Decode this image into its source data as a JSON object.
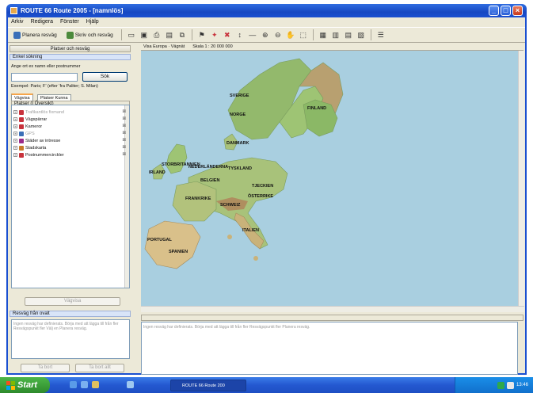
{
  "window": {
    "title": "ROUTE 66 Route 2005 - [namnlös]"
  },
  "menu": [
    "Arkiv",
    "Redigera",
    "Fönster",
    "Hjälp"
  ],
  "toolbar": {
    "plan_route_label": "Planera resväg",
    "print_route_label": "Skriv och resväg"
  },
  "left_panel": {
    "header": "Platser och resväg",
    "search_section_title": "Enkel sökning",
    "search_hint": "Ange ort ex namn eller postnummer",
    "search_input_value": "",
    "search_button": "Sök",
    "example_text": "Exempel: Paris; F’ (efter ‘fra Paliter; S. Milan)",
    "tabs": [
      "Vägvisa",
      "Platser Kunna"
    ],
    "list_header": "Platser (I Översikt)",
    "poi_items": [
      {
        "label": "Trafikantlös fixmand",
        "icon_color": "#c8323c",
        "checked": "☒",
        "dim": true
      },
      {
        "label": "Vägspärrar",
        "icon_color": "#c8323c",
        "checked": "☒",
        "dim": false
      },
      {
        "label": "Kameror",
        "icon_color": "#c8323c",
        "checked": "☒",
        "dim": false
      },
      {
        "label": "GPS",
        "icon_color": "#3a6fb8",
        "checked": "☒",
        "dim": true
      },
      {
        "label": "Städer av intresse",
        "icon_color": "#9b2a8a",
        "checked": "☒",
        "dim": false
      },
      {
        "label": "Stadskarta",
        "icon_color": "#c87a2a",
        "checked": "☒",
        "dim": false
      },
      {
        "label": "Postnummercirckler",
        "icon_color": "#c8323c",
        "checked": "☒",
        "dim": false
      }
    ],
    "route_button": "Vägvisa",
    "notes_section_title": "Resväg från ovalt",
    "notes_placeholder": "Ingen resväg har definierats. Börja med att lägga till från fler Resvägspunkt fler Välj en Planera resväg.",
    "btn_remove": "Ta bort",
    "btn_remove_all": "Ta bort allt"
  },
  "map": {
    "toolbar_label": "Visa Europa · Vägnät",
    "zoom_label": "Skala 1 : 20 000 000",
    "countries": [
      {
        "name": "NORGE"
      },
      {
        "name": "SVERIGE"
      },
      {
        "name": "FINLAND"
      },
      {
        "name": "DANMARK"
      },
      {
        "name": "STORBRITANNIEN"
      },
      {
        "name": "IRLAND"
      },
      {
        "name": "NEDERLÄNDERNA"
      },
      {
        "name": "TYSKLAND"
      },
      {
        "name": "BELGIEN"
      },
      {
        "name": "FRANKRIKE"
      },
      {
        "name": "SCHWEIZ"
      },
      {
        "name": "TJECKIEN"
      },
      {
        "name": "ÖSTERRIKE"
      },
      {
        "name": "ITALIEN"
      },
      {
        "name": "PORTUGAL"
      },
      {
        "name": "SPANIEN"
      }
    ],
    "colors": {
      "sea": "#a9cfe0",
      "land_green": "#8fbf6a",
      "land_tan": "#d9c08a",
      "mountain": "#b0855a"
    }
  },
  "bottom_panel": {
    "notes_text": "Ingen resväg har definierats. Börja med att lägga till från fler Resvägspunkt fler Planera resväg."
  },
  "taskbar": {
    "start_label": "Start",
    "task_item": "ROUTE 66 Route 200",
    "clock": "13:46"
  }
}
